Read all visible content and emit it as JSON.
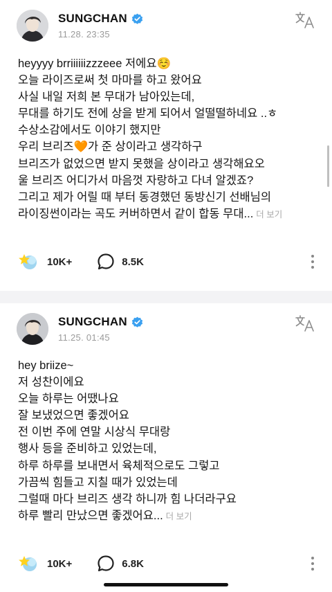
{
  "posts": [
    {
      "author": "SUNGCHAN",
      "timestamp": "11.28. 23:35",
      "lines": [
        "heyyyy brriiiiiizzzeee 저에요☺️",
        "오늘 라이즈로써 첫 마마를 하고 왔어요",
        "사실 내일 저희 본 무대가 남아있는데,",
        "무대를 하기도 전에 상을 받게 되어서 얼떨떨하네요 ..ㅎ",
        "수상소감에서도 이야기 했지만",
        "우리 브리즈🧡가 준 상이라고 생각하구",
        "브리즈가 없었으면 받지 못했을 상이라고 생각해요오",
        "울 브리즈 어디가서 마음껏 자랑하고 다녀 알겠죠?",
        "그리고 제가 어릴 때 부터 동경했던 동방신기 선배님의"
      ],
      "last_line": "라이징썬이라는 곡도 커버하면서 같이 합동 무대...",
      "more_label": "더 보기",
      "reactions": "10K+",
      "comments": "8.5K"
    },
    {
      "author": "SUNGCHAN",
      "timestamp": "11.25. 01:45",
      "lines": [
        "hey briize~",
        "저 성찬이에요",
        "오늘 하루는 어땠나요",
        "잘 보냈었으면 좋겠어요",
        "전 이번 주에 연말 시상식 무대랑",
        "행사 등을 준비하고 있었는데,",
        "하루 하루를 보내면서 육체적으로도 그렇고",
        "가끔씩 힘들고 지칠 때가 있었는데",
        "그럴때 마다 브리즈 생각 하니까 힘 나더라구요"
      ],
      "last_line": "하루 빨리 만났으면 좋겠어요...",
      "more_label": "더 보기",
      "reactions": "10K+",
      "comments": "6.8K"
    }
  ],
  "colors": {
    "verified": "#3aa0f0",
    "divider": "#f3f3f5",
    "more": "#a8a8a8",
    "time": "#9a9a9a"
  },
  "icons": [
    "avatar",
    "verified-badge-icon",
    "translate-icon",
    "reaction-icon",
    "comment-icon",
    "more-options-icon"
  ]
}
